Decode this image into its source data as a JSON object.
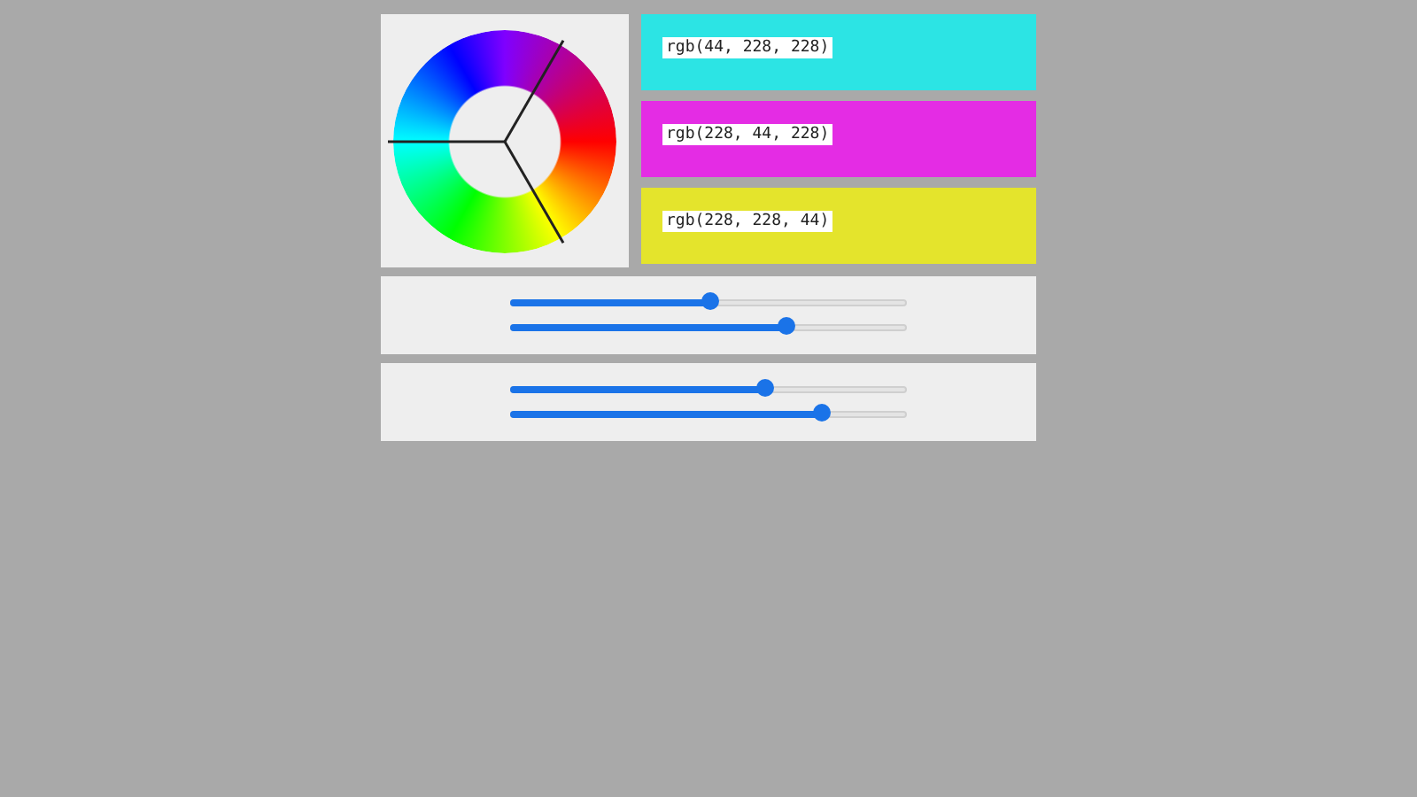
{
  "swatches": [
    {
      "label": "rgb(44, 228, 228)",
      "color": "#2ce4e4"
    },
    {
      "label": "rgb(228, 44, 228)",
      "color": "#e42ce4"
    },
    {
      "label": "rgb(228, 228, 44)",
      "color": "#e4e42c"
    }
  ],
  "slider_groups": [
    {
      "sliders": [
        {
          "level": 0.5
        },
        {
          "level": 0.69
        }
      ]
    },
    {
      "sliders": [
        {
          "level": 0.64
        },
        {
          "level": 0.78
        }
      ]
    }
  ]
}
